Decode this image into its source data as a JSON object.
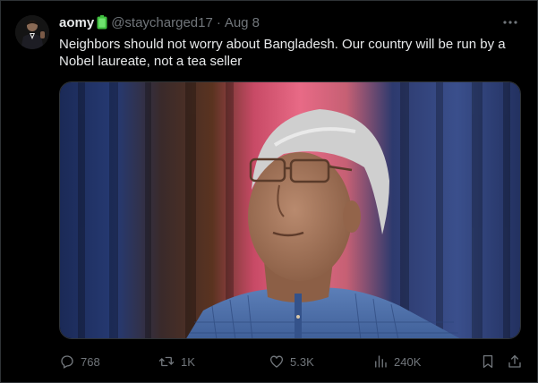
{
  "tweet": {
    "author": {
      "display_name": "aomy",
      "badge_icon": "battery-icon",
      "handle": "@staycharged17",
      "separator": "·",
      "date": "Aug 8"
    },
    "text": "Neighbors should not worry about Bangladesh. Our country will be run by a Nobel laureate, not a tea seller",
    "media": {
      "kind": "photo",
      "description_icon": "portrait-photo"
    },
    "actions": {
      "reply_count": "768",
      "retweet_count": "1K",
      "like_count": "5.3K",
      "view_count": "240K"
    }
  },
  "colors": {
    "background": "#000000",
    "text_primary": "#e7e9ea",
    "text_secondary": "#71767b",
    "border": "#2f3336",
    "battery_green": "#3fbf3f"
  }
}
